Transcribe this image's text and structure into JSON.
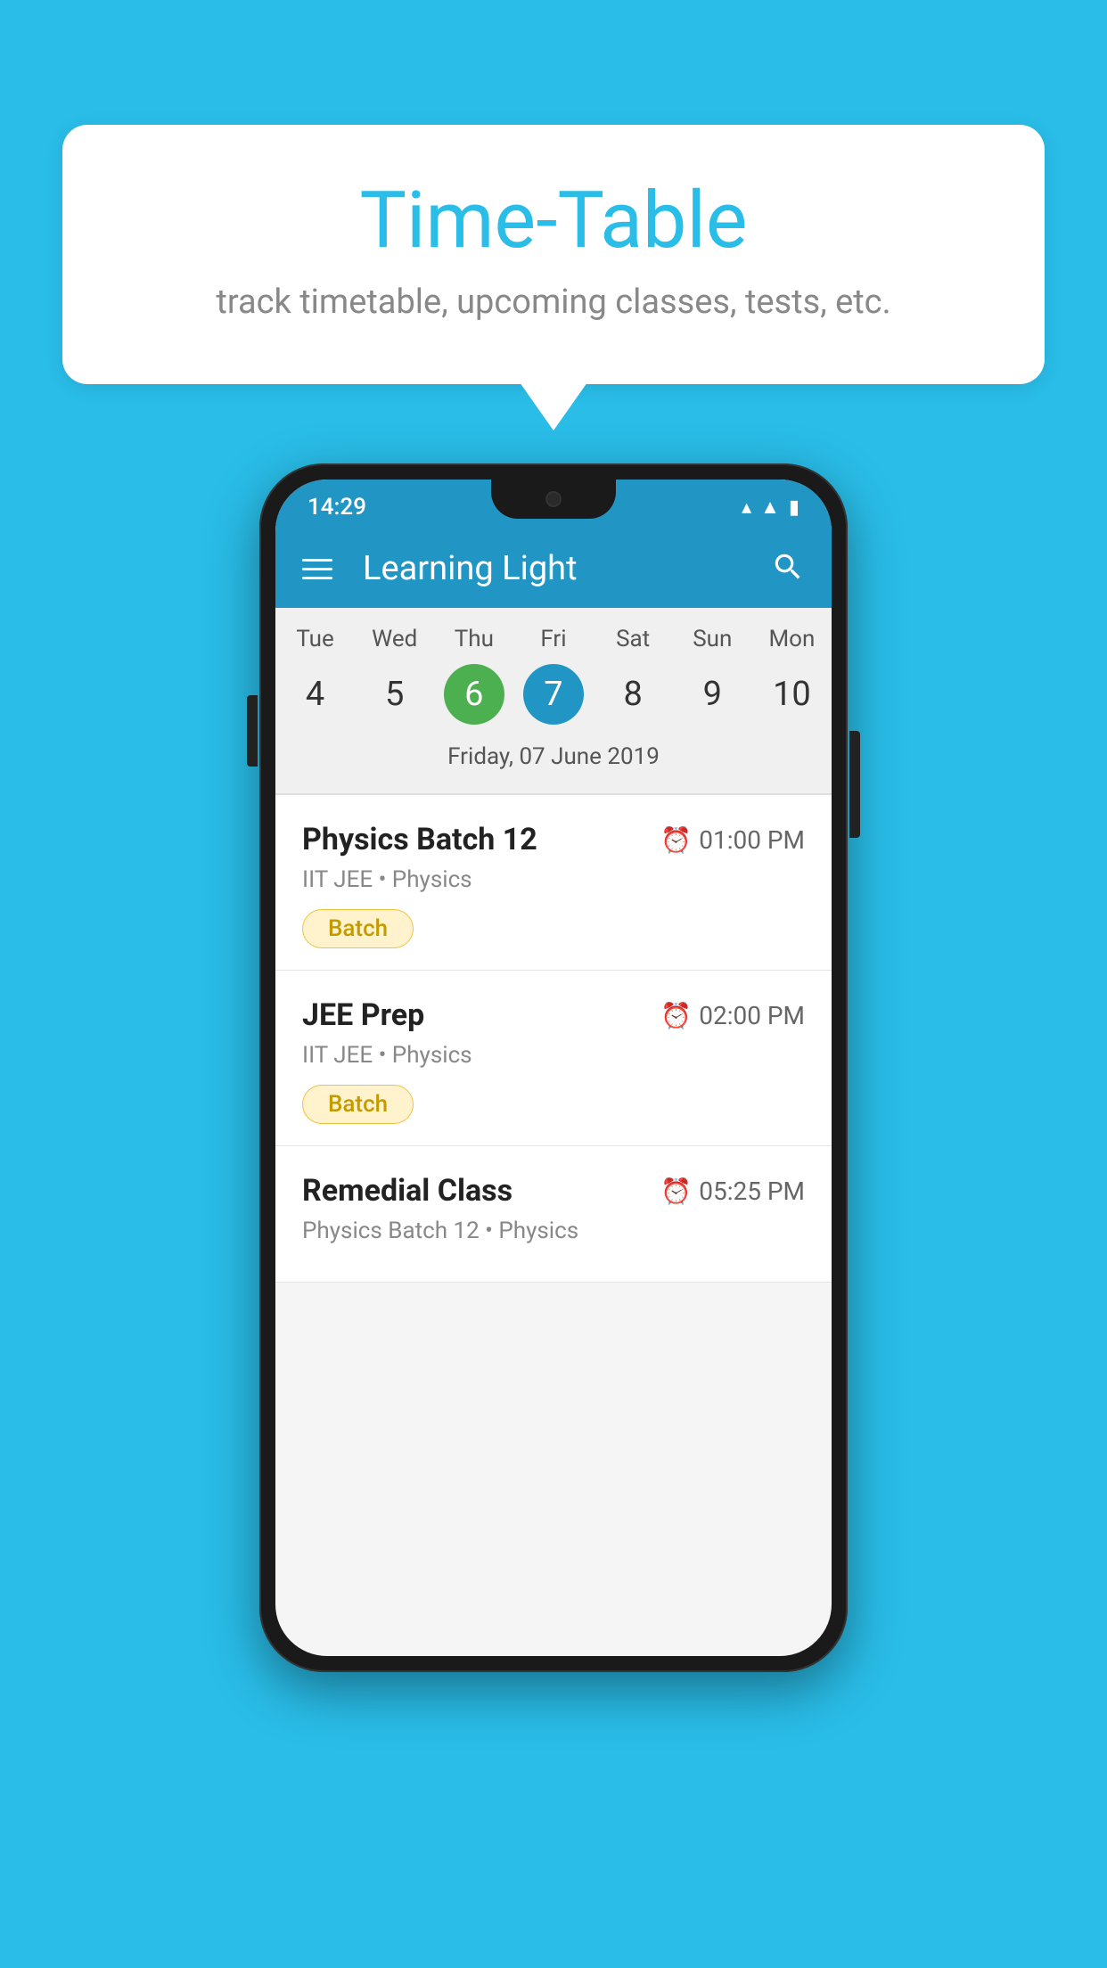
{
  "background_color": "#29bde8",
  "speech_bubble": {
    "title": "Time-Table",
    "subtitle": "track timetable, upcoming classes, tests, etc."
  },
  "phone": {
    "status_bar": {
      "time": "14:29"
    },
    "app_bar": {
      "title": "Learning Light"
    },
    "calendar": {
      "days": [
        {
          "label": "Tue",
          "num": "4"
        },
        {
          "label": "Wed",
          "num": "5"
        },
        {
          "label": "Thu",
          "num": "6",
          "state": "today"
        },
        {
          "label": "Fri",
          "num": "7",
          "state": "selected"
        },
        {
          "label": "Sat",
          "num": "8"
        },
        {
          "label": "Sun",
          "num": "9"
        },
        {
          "label": "Mon",
          "num": "10"
        }
      ],
      "selected_date_label": "Friday, 07 June 2019"
    },
    "schedule": [
      {
        "title": "Physics Batch 12",
        "time": "01:00 PM",
        "subtitle": "IIT JEE • Physics",
        "tag": "Batch"
      },
      {
        "title": "JEE Prep",
        "time": "02:00 PM",
        "subtitle": "IIT JEE • Physics",
        "tag": "Batch"
      },
      {
        "title": "Remedial Class",
        "time": "05:25 PM",
        "subtitle": "Physics Batch 12 • Physics",
        "tag": ""
      }
    ]
  }
}
